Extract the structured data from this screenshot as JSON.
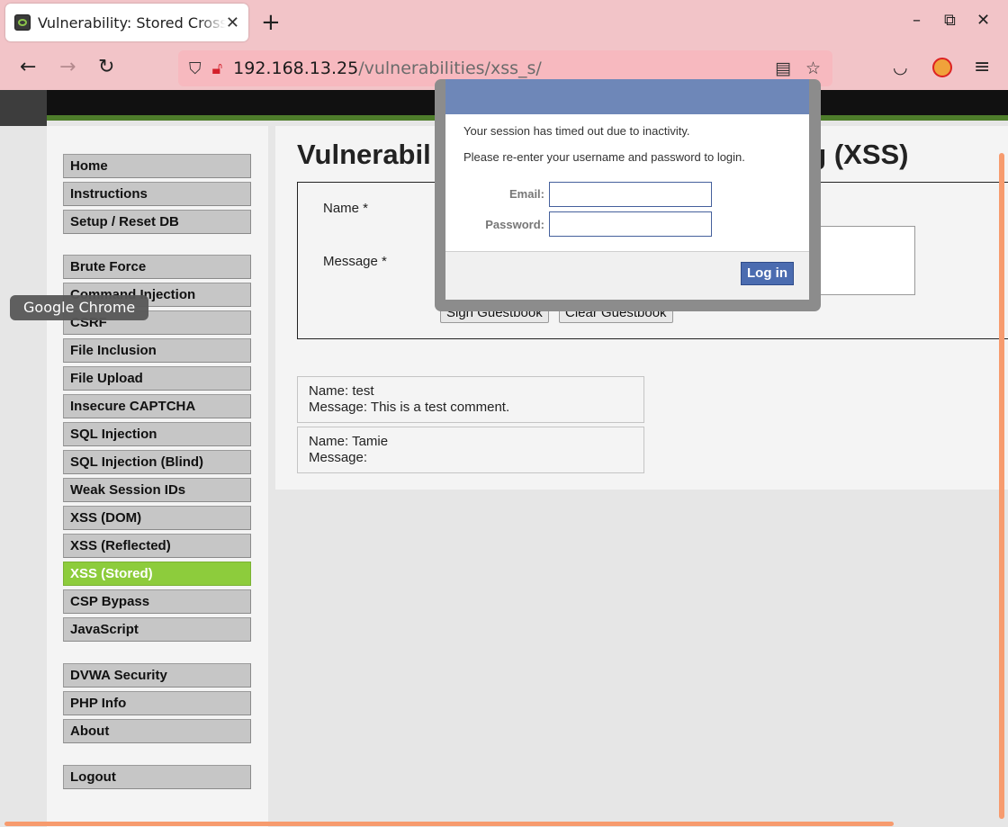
{
  "browser": {
    "tab_title": "Vulnerability: Stored Cross Site Scripting (XSS)",
    "tab_close": "✕",
    "new_tab": "+",
    "url_host": "192.168.13.25",
    "url_path": "/vulnerabilities/xss_s/",
    "icons": [
      "back-arrow-icon",
      "forward-arrow-icon",
      "reload-icon",
      "shield-icon",
      "insecure-lock-icon",
      "reader-view-icon",
      "star-icon",
      "pocket-icon",
      "extension-icon",
      "menu-icon"
    ]
  },
  "tooltip": "Google Chrome",
  "sidebar": {
    "groups": [
      [
        "Home",
        "Instructions",
        "Setup / Reset DB"
      ],
      [
        "Brute Force",
        "Command Injection",
        "CSRF",
        "File Inclusion",
        "File Upload",
        "Insecure CAPTCHA",
        "SQL Injection",
        "SQL Injection (Blind)",
        "Weak Session IDs",
        "XSS (DOM)",
        "XSS (Reflected)",
        "XSS (Stored)",
        "CSP Bypass",
        "JavaScript"
      ],
      [
        "DVWA Security",
        "PHP Info",
        "About"
      ],
      [
        "Logout"
      ]
    ],
    "active": "XSS (Stored)"
  },
  "main": {
    "title_left": "Vulnerabil",
    "title_right": "ing (XSS)",
    "form": {
      "name_label": "Name *",
      "message_label": "Message *",
      "sign_button": "Sign Guestbook",
      "clear_button": "Clear Guestbook"
    },
    "comments": [
      {
        "name": "Name: test",
        "message": "Message: This is a test comment."
      },
      {
        "name": "Name: Tamie",
        "message": "Message:"
      }
    ]
  },
  "modal": {
    "line1": "Your session has timed out due to inactivity.",
    "line2": "Please re-enter your username and password to login.",
    "email_label": "Email:",
    "password_label": "Password:",
    "login_button": "Log in",
    "header_color": "#6e87b8"
  },
  "colors": {
    "active_menu": "#8dcc3c",
    "browser_chrome": "#f2c4c8",
    "scrollbar": "#f79b6e"
  }
}
